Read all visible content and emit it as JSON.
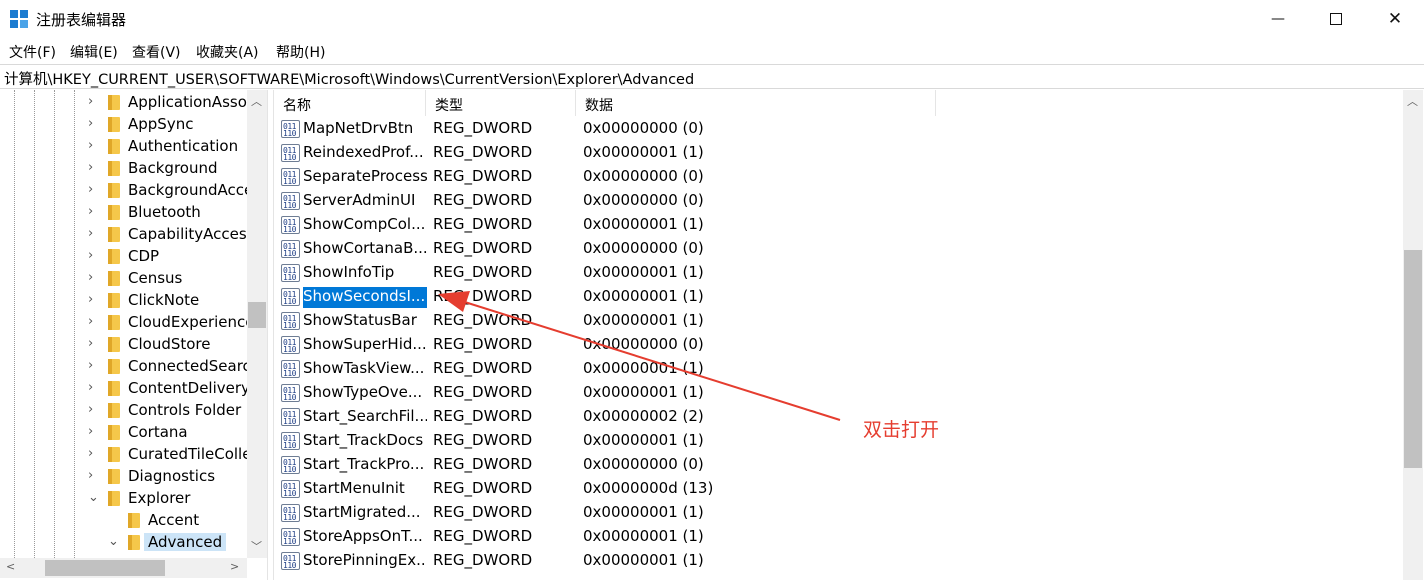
{
  "window": {
    "title": "注册表编辑器",
    "min_glyph": "—",
    "close_glyph": "✕"
  },
  "menu": [
    "文件(F)",
    "编辑(E)",
    "查看(V)",
    "收藏夹(A)",
    "帮助(H)"
  ],
  "address": "计算机\\HKEY_CURRENT_USER\\SOFTWARE\\Microsoft\\Windows\\CurrentVersion\\Explorer\\Advanced",
  "tree": {
    "items": [
      {
        "label": "ApplicationAsso",
        "expanded": false
      },
      {
        "label": "AppSync",
        "expanded": false
      },
      {
        "label": "Authentication",
        "expanded": false
      },
      {
        "label": "Background",
        "expanded": false
      },
      {
        "label": "BackgroundAcce",
        "expanded": false
      },
      {
        "label": "Bluetooth",
        "expanded": false
      },
      {
        "label": "CapabilityAccess",
        "expanded": false
      },
      {
        "label": "CDP",
        "expanded": false
      },
      {
        "label": "Census",
        "expanded": false
      },
      {
        "label": "ClickNote",
        "expanded": false
      },
      {
        "label": "CloudExperience",
        "expanded": false
      },
      {
        "label": "CloudStore",
        "expanded": false
      },
      {
        "label": "ConnectedSearc",
        "expanded": false
      },
      {
        "label": "ContentDelivery",
        "expanded": false
      },
      {
        "label": "Controls Folder",
        "expanded": false
      },
      {
        "label": "Cortana",
        "expanded": false
      },
      {
        "label": "CuratedTileColle",
        "expanded": false
      },
      {
        "label": "Diagnostics",
        "expanded": false
      },
      {
        "label": "Explorer",
        "expanded": true
      }
    ],
    "children": [
      {
        "label": "Accent"
      },
      {
        "label": "Advanced",
        "selected": true
      }
    ]
  },
  "list": {
    "columns": {
      "name": "名称",
      "type": "类型",
      "data": "数据"
    },
    "rows": [
      {
        "name": "MapNetDrvBtn",
        "type": "REG_DWORD",
        "data": "0x00000000 (0)"
      },
      {
        "name": "ReindexedProf...",
        "type": "REG_DWORD",
        "data": "0x00000001 (1)"
      },
      {
        "name": "SeparateProcess",
        "type": "REG_DWORD",
        "data": "0x00000000 (0)"
      },
      {
        "name": "ServerAdminUI",
        "type": "REG_DWORD",
        "data": "0x00000000 (0)"
      },
      {
        "name": "ShowCompCol...",
        "type": "REG_DWORD",
        "data": "0x00000001 (1)"
      },
      {
        "name": "ShowCortanaB...",
        "type": "REG_DWORD",
        "data": "0x00000000 (0)"
      },
      {
        "name": "ShowInfoTip",
        "type": "REG_DWORD",
        "data": "0x00000001 (1)"
      },
      {
        "name": "ShowSecondsI...",
        "type": "REG_DWORD",
        "data": "0x00000001 (1)",
        "selected": true
      },
      {
        "name": "ShowStatusBar",
        "type": "REG_DWORD",
        "data": "0x00000001 (1)"
      },
      {
        "name": "ShowSuperHid...",
        "type": "REG_DWORD",
        "data": "0x00000000 (0)"
      },
      {
        "name": "ShowTaskView...",
        "type": "REG_DWORD",
        "data": "0x00000001 (1)"
      },
      {
        "name": "ShowTypeOve...",
        "type": "REG_DWORD",
        "data": "0x00000001 (1)"
      },
      {
        "name": "Start_SearchFil...",
        "type": "REG_DWORD",
        "data": "0x00000002 (2)"
      },
      {
        "name": "Start_TrackDocs",
        "type": "REG_DWORD",
        "data": "0x00000001 (1)"
      },
      {
        "name": "Start_TrackPro...",
        "type": "REG_DWORD",
        "data": "0x00000000 (0)"
      },
      {
        "name": "StartMenuInit",
        "type": "REG_DWORD",
        "data": "0x0000000d (13)"
      },
      {
        "name": "StartMigrated...",
        "type": "REG_DWORD",
        "data": "0x00000001 (1)"
      },
      {
        "name": "StoreAppsOnT...",
        "type": "REG_DWORD",
        "data": "0x00000001 (1)"
      },
      {
        "name": "StorePinningEx...",
        "type": "REG_DWORD",
        "data": "0x00000001 (1)"
      }
    ]
  },
  "annotation": {
    "text": "双击打开",
    "color": "#e53d2f"
  },
  "colors": {
    "selection": "#0078d7",
    "tree_selection": "#cce4f7"
  }
}
